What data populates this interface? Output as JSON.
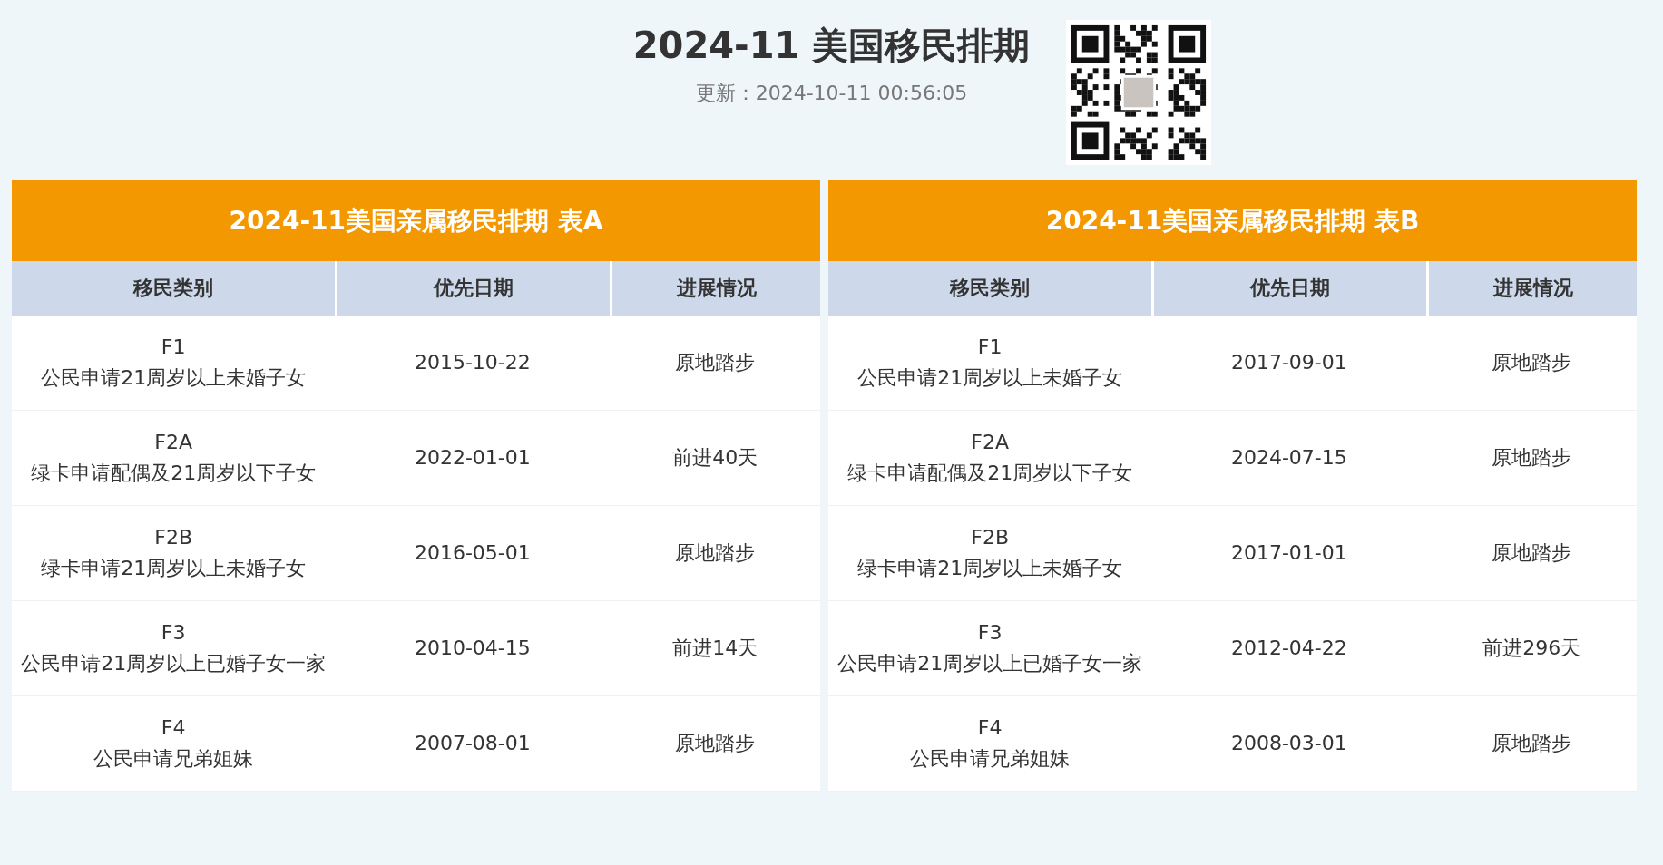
{
  "header": {
    "title": "2024-11 美国移民排期",
    "updated": "更新：2024-10-11 00:56:05"
  },
  "tables": [
    {
      "title": "2024-11美国亲属移民排期 表A",
      "columns": [
        "移民类别",
        "优先日期",
        "进展情况"
      ],
      "rows": [
        {
          "category": "F1\n公民申请21周岁以上未婚子女",
          "date": "2015-10-22",
          "progress": "原地踏步"
        },
        {
          "category": "F2A\n绿卡申请配偶及21周岁以下子女",
          "date": "2022-01-01",
          "progress": "前进40天"
        },
        {
          "category": "F2B\n绿卡申请21周岁以上未婚子女",
          "date": "2016-05-01",
          "progress": "原地踏步"
        },
        {
          "category": "F3\n公民申请21周岁以上已婚子女一家",
          "date": "2010-04-15",
          "progress": "前进14天"
        },
        {
          "category": "F4\n公民申请兄弟姐妹",
          "date": "2007-08-01",
          "progress": "原地踏步"
        }
      ]
    },
    {
      "title": "2024-11美国亲属移民排期 表B",
      "columns": [
        "移民类别",
        "优先日期",
        "进展情况"
      ],
      "rows": [
        {
          "category": "F1\n公民申请21周岁以上未婚子女",
          "date": "2017-09-01",
          "progress": "原地踏步"
        },
        {
          "category": "F2A\n绿卡申请配偶及21周岁以下子女",
          "date": "2024-07-15",
          "progress": "原地踏步"
        },
        {
          "category": "F2B\n绿卡申请21周岁以上未婚子女",
          "date": "2017-01-01",
          "progress": "原地踏步"
        },
        {
          "category": "F3\n公民申请21周岁以上已婚子女一家",
          "date": "2012-04-22",
          "progress": "前进296天"
        },
        {
          "category": "F4\n公民申请兄弟姐妹",
          "date": "2008-03-01",
          "progress": "原地踏步"
        }
      ]
    }
  ]
}
